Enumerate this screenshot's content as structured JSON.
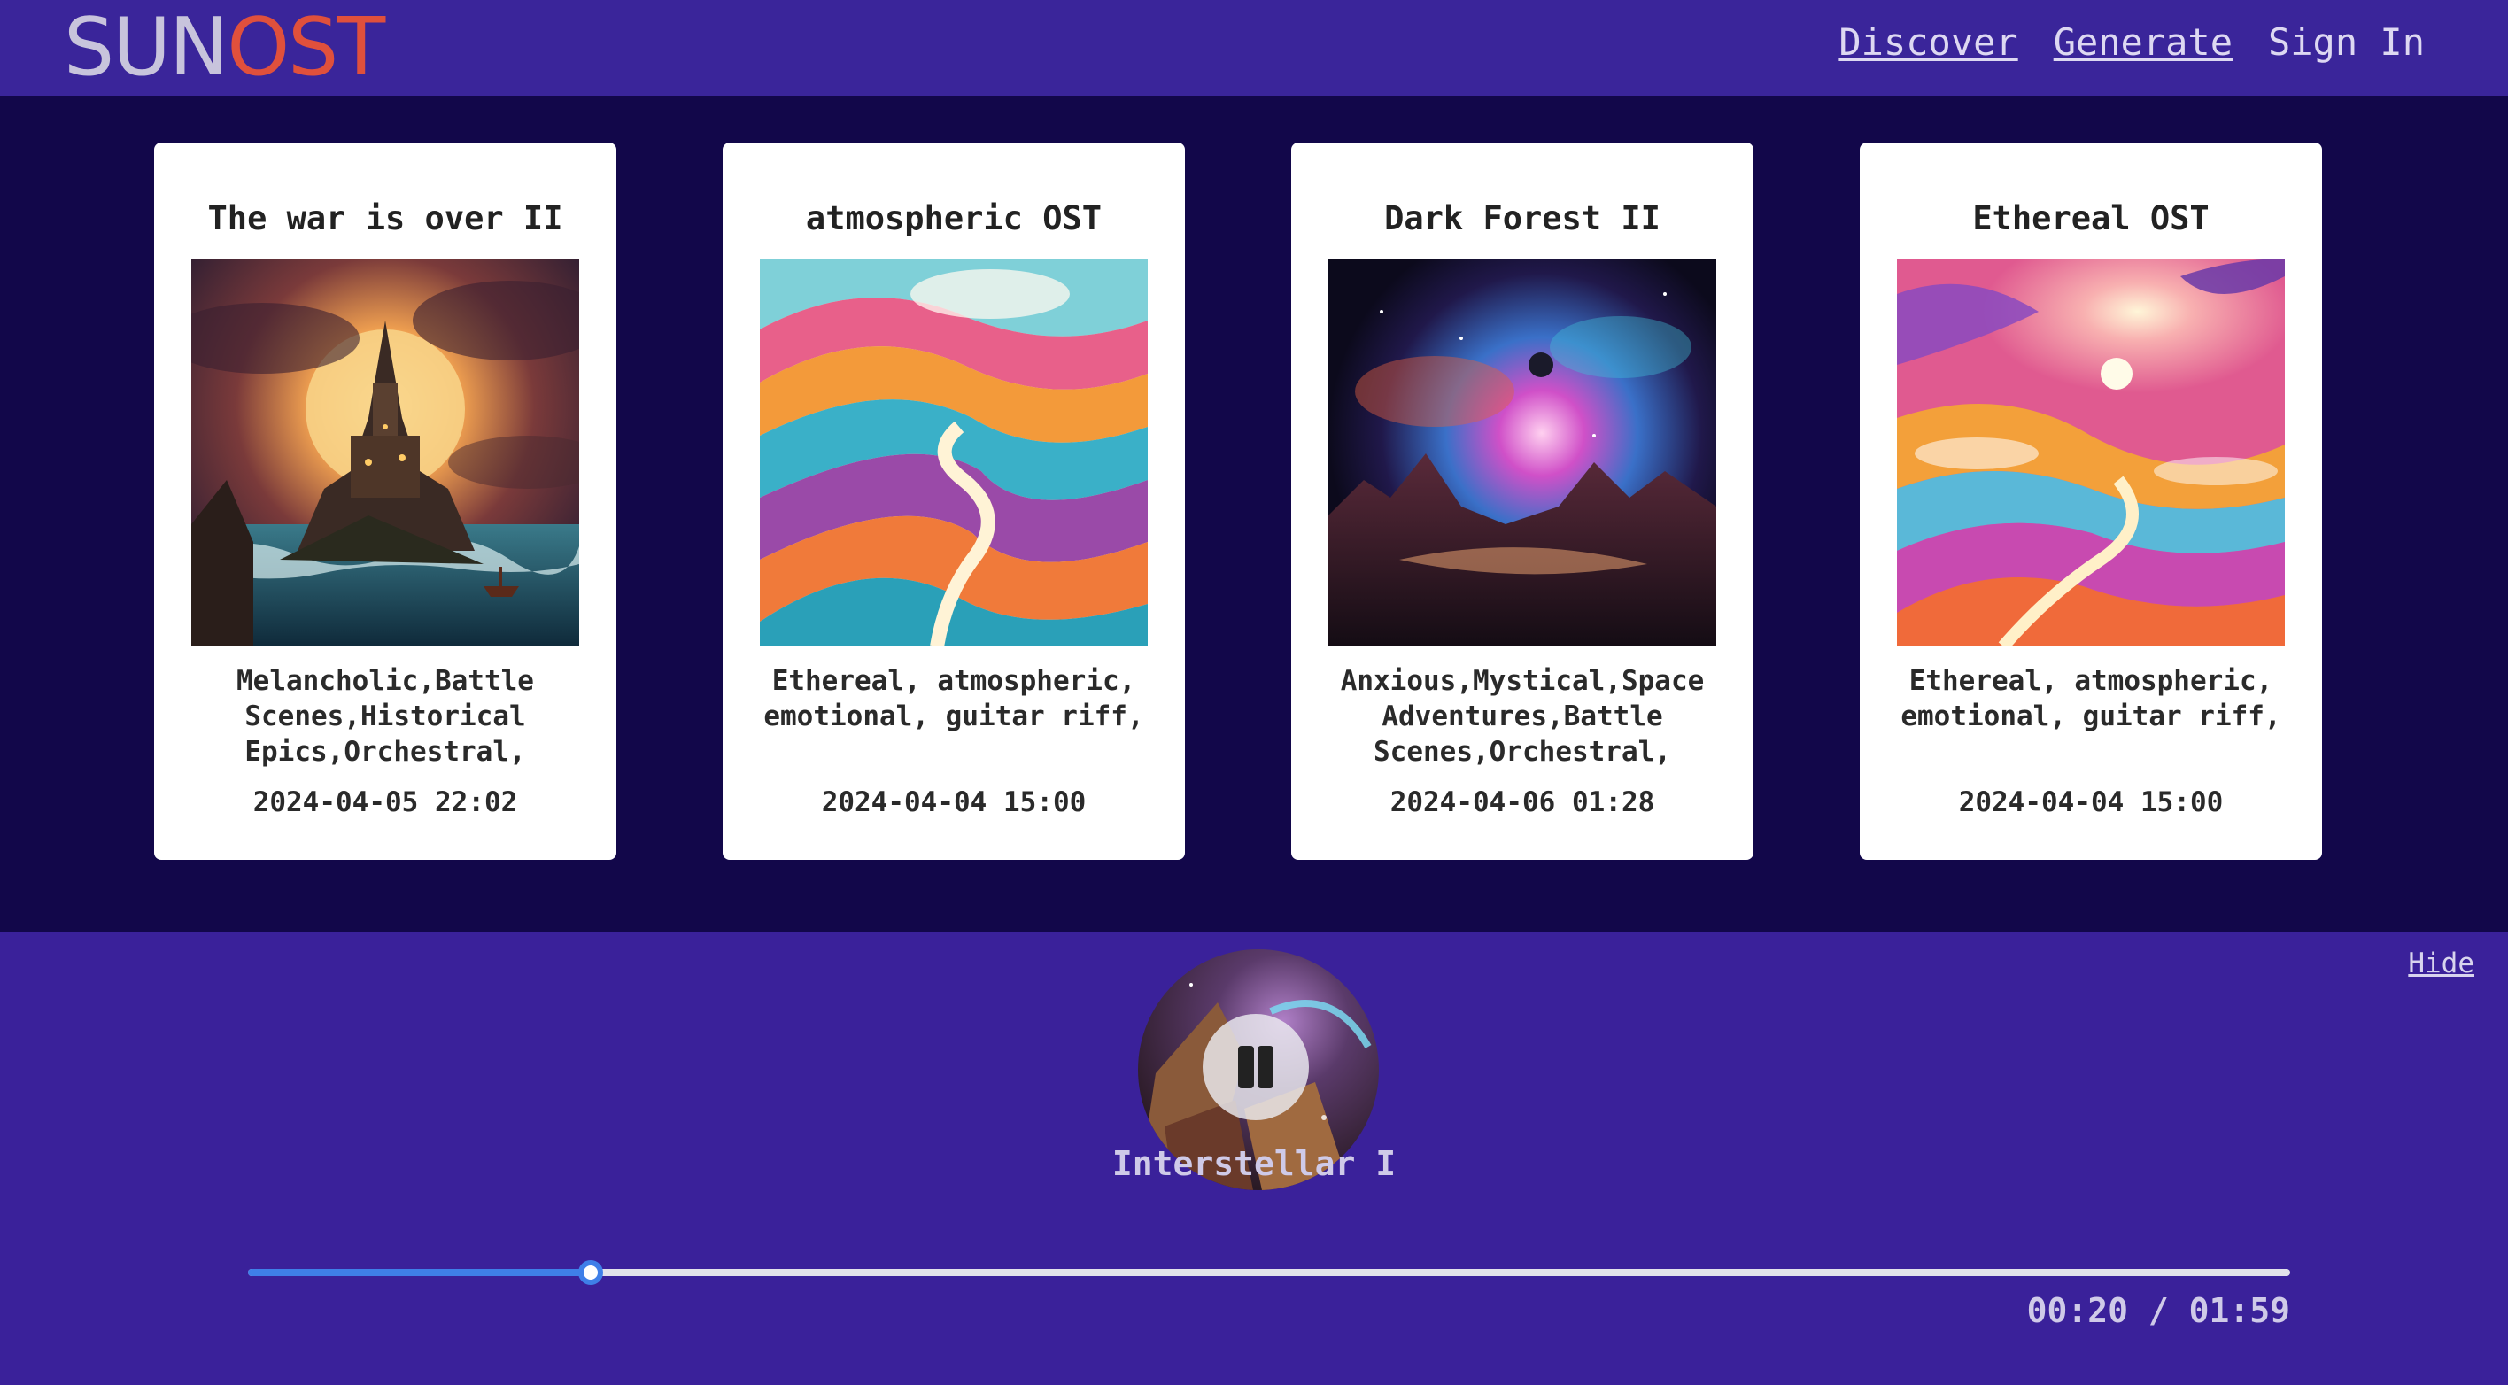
{
  "header": {
    "logo_part1": "SUN",
    "logo_part2": "OST",
    "nav": {
      "discover": "Discover",
      "generate": "Generate",
      "sign_in": "Sign In"
    }
  },
  "cards": [
    {
      "title": "The war is over II",
      "tags": "Melancholic,Battle Scenes,Historical Epics,Orchestral,",
      "date": "2024-04-05 22:02",
      "art_icon": "castle-art"
    },
    {
      "title": "atmospheric OST",
      "tags": "Ethereal, atmospheric, emotional, guitar riff,",
      "date": "2024-04-04 15:00",
      "art_icon": "swirl-art"
    },
    {
      "title": "Dark Forest II",
      "tags": "Anxious,Mystical,Space Adventures,Battle Scenes,Orchestral,",
      "date": "2024-04-06 01:28",
      "art_icon": "nebula-art"
    },
    {
      "title": "Ethereal OST",
      "tags": "Ethereal, atmospheric, emotional, guitar riff,",
      "date": "2024-04-04 15:00",
      "art_icon": "sunset-swirl-art"
    }
  ],
  "player": {
    "hide_label": "Hide",
    "track_title": "Interstellar I",
    "time_display": "00:20 / 01:59",
    "progress_fraction": 0.168,
    "state": "playing",
    "accent_color": "#3f7fe8"
  },
  "colors": {
    "header_bg": "#3a259a",
    "page_bg": "#12074a",
    "player_bg": "#3a219a",
    "logo_accent": "#e0503c"
  }
}
